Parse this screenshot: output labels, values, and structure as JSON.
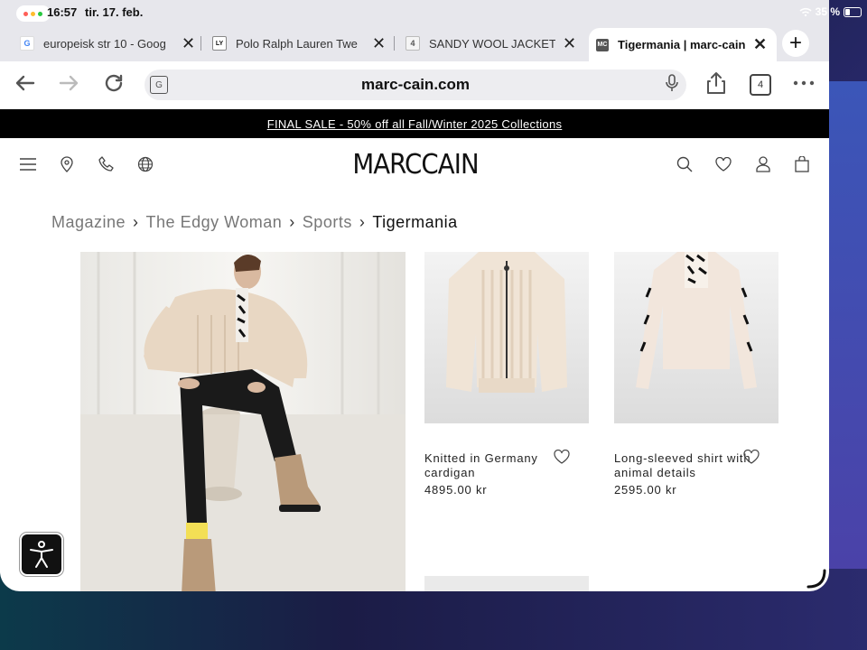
{
  "status_bar": {
    "time": "16:57",
    "date": "tir. 17. feb.",
    "battery": "35 %"
  },
  "tabs": [
    {
      "label": "europeisk str 10 - Goog",
      "favicon": "G"
    },
    {
      "label": "Polo Ralph Lauren Twe",
      "favicon": "LY"
    },
    {
      "label": "SANDY WOOL JACKET",
      "favicon": "4"
    },
    {
      "label": "Tigermania | marc-cain",
      "favicon": "MC",
      "active": true
    }
  ],
  "toolbar": {
    "url": "marc-cain.com",
    "tabs_count": "4"
  },
  "promo": {
    "text": "FINAL SALE - 50% off all Fall/Winter 2025 Collections"
  },
  "site": {
    "logo": "MARCCAIN"
  },
  "breadcrumb": [
    "Magazine",
    "The Edgy Woman",
    "Sports",
    "Tigermania"
  ],
  "products": [
    {
      "name": "Knitted in Germany cardigan",
      "price": "4895.00 kr"
    },
    {
      "name": "Long-sleeved shirt with animal details",
      "price": "2595.00 kr"
    }
  ],
  "icons": {
    "menu": "hamburger-icon",
    "location": "location-pin-icon",
    "phone": "phone-icon",
    "language": "globe-icon",
    "search": "search-icon",
    "wishlist": "heart-icon",
    "account": "user-icon",
    "cart": "bag-icon"
  }
}
